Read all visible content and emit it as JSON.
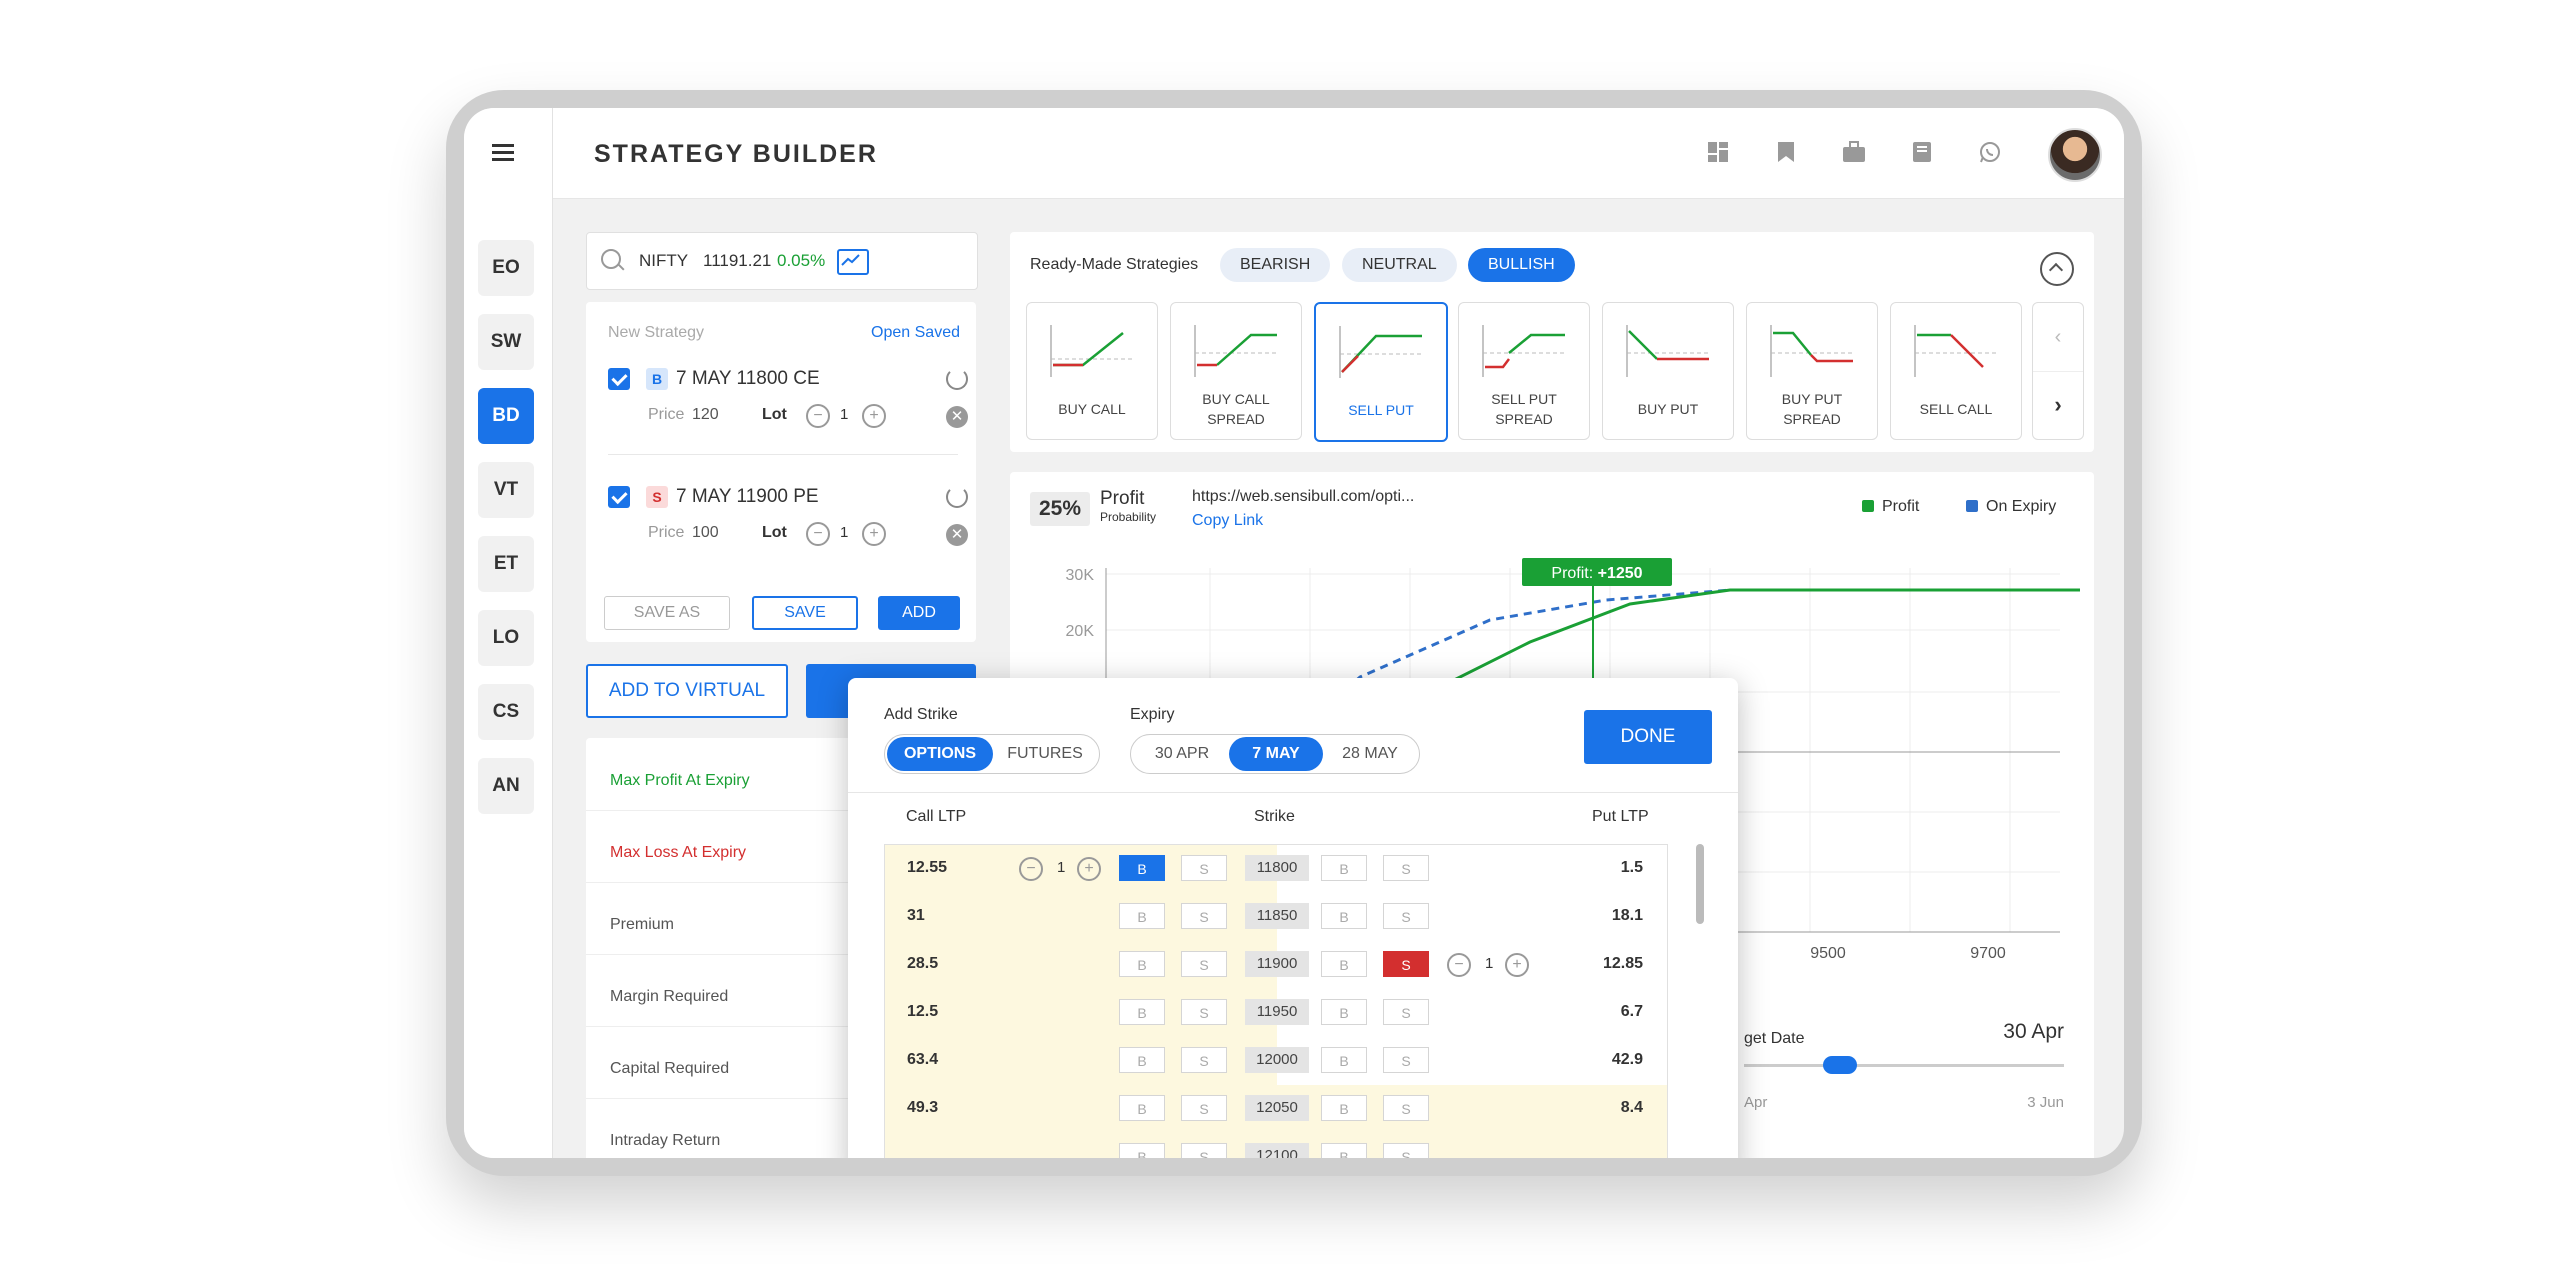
{
  "app": {
    "title": "STRATEGY BUILDER"
  },
  "header": {
    "icons": [
      "dashboard-icon",
      "bookmark-icon",
      "briefcase-icon",
      "book-icon",
      "whatsapp-icon"
    ]
  },
  "sidebar": {
    "items": [
      {
        "label": "EO"
      },
      {
        "label": "SW"
      },
      {
        "label": "BD",
        "active": true
      },
      {
        "label": "VT"
      },
      {
        "label": "ET"
      },
      {
        "label": "LO"
      },
      {
        "label": "CS"
      },
      {
        "label": "AN"
      }
    ]
  },
  "search": {
    "symbol": "NIFTY",
    "price": "11191.21",
    "change": "0.05%"
  },
  "strategy": {
    "new_label": "New Strategy",
    "open_saved": "Open Saved",
    "legs": [
      {
        "type": "B",
        "name": "7 MAY 11800 CE",
        "price_label": "Price",
        "price": "120",
        "lot_label": "Lot",
        "lot": "1"
      },
      {
        "type": "S",
        "name": "7 MAY 11900 PE",
        "price_label": "Price",
        "price": "100",
        "lot_label": "Lot",
        "lot": "1"
      }
    ],
    "save_as": "SAVE AS",
    "save": "SAVE",
    "add": "ADD"
  },
  "add_to_virtual": "ADD TO VIRTUAL",
  "metrics": [
    {
      "label": "Max Profit At Expiry",
      "color": "#1aa035"
    },
    {
      "label": "Max Loss At Expiry",
      "color": "#d32f2f"
    },
    {
      "label": "Premium"
    },
    {
      "label": "Margin Required"
    },
    {
      "label": "Capital Required"
    },
    {
      "label": "Intraday Return"
    }
  ],
  "ready_made": {
    "title": "Ready-Made Strategies",
    "filters": [
      {
        "label": "BEARISH"
      },
      {
        "label": "NEUTRAL"
      },
      {
        "label": "BULLISH",
        "active": true
      }
    ],
    "strategies": [
      {
        "l1": "BUY CALL",
        "l2": ""
      },
      {
        "l1": "BUY CALL",
        "l2": "SPREAD"
      },
      {
        "l1": "SELL PUT",
        "l2": "",
        "active": true
      },
      {
        "l1": "SELL PUT",
        "l2": "SPREAD"
      },
      {
        "l1": "BUY PUT",
        "l2": ""
      },
      {
        "l1": "BUY PUT",
        "l2": "SPREAD"
      },
      {
        "l1": "SELL CALL",
        "l2": ""
      }
    ]
  },
  "payoff": {
    "probability": "25%",
    "prob_l1": "Profit",
    "prob_l2": "Probability",
    "url": "https://web.sensibull.com/opti...",
    "copy_link": "Copy Link",
    "legend": [
      {
        "label": "Profit",
        "color": "#1aa035"
      },
      {
        "label": "On Expiry",
        "color": "#2f6fc9"
      }
    ],
    "tooltip_prefix": "Profit: ",
    "tooltip_value": "+1250",
    "target_label": "get Date",
    "target_value": "30 Apr",
    "slider_min": "Apr",
    "slider_max": "3 Jun",
    "slider_position": 0.3
  },
  "chart_data": {
    "type": "line",
    "yticks": [
      "30K",
      "20K"
    ],
    "xticks": [
      "9500",
      "9700"
    ],
    "series": [
      {
        "name": "Profit",
        "color": "#1aa035",
        "style": "solid"
      },
      {
        "name": "On Expiry",
        "color": "#2f6fc9",
        "style": "dashed"
      }
    ],
    "annotation": "Profit: +1250"
  },
  "modal": {
    "add_strike": "Add Strike",
    "instrument": [
      {
        "label": "OPTIONS",
        "active": true
      },
      {
        "label": "FUTURES"
      }
    ],
    "expiry_label": "Expiry",
    "expiry": [
      {
        "label": "30 APR"
      },
      {
        "label": "7 MAY",
        "active": true
      },
      {
        "label": "28 MAY"
      }
    ],
    "done": "DONE",
    "call_ltp": "Call LTP",
    "strike": "Strike",
    "put_ltp": "Put LTP",
    "b": "B",
    "s": "S",
    "rows": [
      {
        "call": "12.55",
        "strike": "11800",
        "put": "1.5",
        "call_buy": true,
        "call_lot": "1"
      },
      {
        "call": "31",
        "strike": "11850",
        "put": "18.1"
      },
      {
        "call": "28.5",
        "strike": "11900",
        "put": "12.85",
        "put_sell": true,
        "put_lot": "1"
      },
      {
        "call": "12.5",
        "strike": "11950",
        "put": "6.7"
      },
      {
        "call": "63.4",
        "strike": "12000",
        "put": "42.9"
      },
      {
        "call": "49.3",
        "strike": "12050",
        "put": "8.4",
        "hl": true
      },
      {
        "call": "",
        "strike": "12100",
        "put": ""
      }
    ]
  }
}
